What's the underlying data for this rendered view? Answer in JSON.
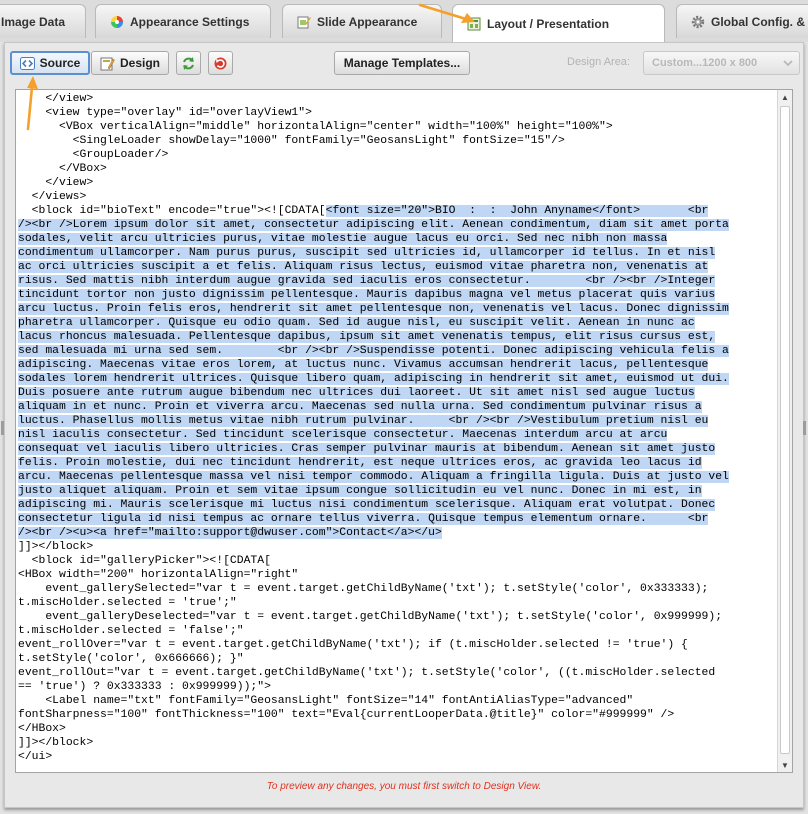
{
  "tabs": [
    {
      "label": "Image Data",
      "active": false
    },
    {
      "label": "Appearance Settings",
      "active": false
    },
    {
      "label": "Slide Appearance",
      "active": false
    },
    {
      "label": "Layout / Presentation",
      "active": true
    },
    {
      "label": "Global Config. &",
      "active": false
    }
  ],
  "toolbar": {
    "source_label": "Source",
    "design_label": "Design",
    "manage_templates_label": "Manage Templates...",
    "design_area_label": "Design Area:",
    "design_area_value": "Custom...1200 x 800"
  },
  "colors": {
    "accent_arrow": "#f5a02a",
    "selection": "#bfd6f4",
    "notice_text": "#e0311e"
  },
  "code": {
    "before_selection": "    </view>\n    <view type=\"overlay\" id=\"overlayView1\">\n      <VBox verticalAlign=\"middle\" horizontalAlign=\"center\" width=\"100%\" height=\"100%\">\n        <SingleLoader showDelay=\"1000\" fontFamily=\"GeosansLight\" fontSize=\"15\"/>\n        <GroupLoader/>\n      </VBox>\n    </view>\n  </views>\n  <block id=\"bioText\" encode=\"true\"><![CDATA[",
    "selected": "<font size=\"20\">BIO  :  :  John Anyname</font>       <br\n/><br />Lorem ipsum dolor sit amet, consectetur adipiscing elit. Aenean condimentum, diam sit amet porta\nsodales, velit arcu ultricies purus, vitae molestie augue lacus eu orci. Sed nec nibh non massa\ncondimentum ullamcorper. Nam purus purus, suscipit sed ultricies id, ullamcorper id tellus. In et nisl\nac orci ultricies suscipit a et felis. Aliquam risus lectus, euismod vitae pharetra non, venenatis at\nrisus. Sed mattis nibh interdum augue gravida sed iaculis eros consectetur.        <br /><br />Integer\ntincidunt tortor non justo dignissim pellentesque. Mauris dapibus magna vel metus placerat quis varius\narcu luctus. Proin felis eros, hendrerit sit amet pellentesque non, venenatis vel lacus. Donec dignissim\npharetra ullamcorper. Quisque eu odio quam. Sed id augue nisl, eu suscipit velit. Aenean in nunc ac\nlacus rhoncus malesuada. Pellentesque dapibus, ipsum sit amet venenatis tempus, elit risus cursus est,\nsed malesuada mi urna sed sem.        <br /><br />Suspendisse potenti. Donec adipiscing vehicula felis a\nadipiscing. Maecenas vitae eros lorem, at luctus nunc. Vivamus accumsan hendrerit lacus, pellentesque\nsodales lorem hendrerit ultrices. Quisque libero quam, adipiscing in hendrerit sit amet, euismod ut dui.\nDuis posuere ante rutrum augue bibendum nec ultrices dui laoreet. Ut sit amet nisl sed augue luctus\naliquam in et nunc. Proin et viverra arcu. Maecenas sed nulla urna. Sed condimentum pulvinar risus a\nluctus. Phasellus mollis metus vitae nibh rutrum pulvinar.     <br /><br />Vestibulum pretium nisl eu\nnisl iaculis consectetur. Sed tincidunt scelerisque consectetur. Maecenas interdum arcu at arcu\nconsequat vel iaculis libero ultricies. Cras semper pulvinar mauris at bibendum. Aenean sit amet justo\nfelis. Proin molestie, dui nec tincidunt hendrerit, est neque ultrices eros, ac gravida leo lacus id\narcu. Maecenas pellentesque massa vel nisi tempor commodo. Aliquam a fringilla ligula. Duis at justo vel\njusto aliquet aliquam. Proin et sem vitae ipsum congue sollicitudin eu vel nunc. Donec in mi est, in\nadipiscing mi. Mauris scelerisque mi luctus nisi condimentum scelerisque. Aliquam erat volutpat. Donec\nconsectetur ligula id nisi tempus ac ornare tellus viverra. Quisque tempus elementum ornare.      <br\n/><br /><u><a href=\"mailto:support@dwuser.com\">Contact</a></u>",
    "after_selection": "\n]]></block>\n  <block id=\"galleryPicker\"><![CDATA[\n<HBox width=\"200\" horizontalAlign=\"right\"\n    event_gallerySelected=\"var t = event.target.getChildByName('txt'); t.setStyle('color', 0x333333);\nt.miscHolder.selected = 'true';\"\n    event_galleryDeselected=\"var t = event.target.getChildByName('txt'); t.setStyle('color', 0x999999);\nt.miscHolder.selected = 'false';\"\nevent_rollOver=\"var t = event.target.getChildByName('txt'); if (t.miscHolder.selected != 'true') {\nt.setStyle('color', 0x666666); }\"\nevent_rollOut=\"var t = event.target.getChildByName('txt'); t.setStyle('color', ((t.miscHolder.selected\n== 'true') ? 0x333333 : 0x999999));\">\n    <Label name=\"txt\" fontFamily=\"GeosansLight\" fontSize=\"14\" fontAntiAliasType=\"advanced\"\nfontSharpness=\"100\" fontThickness=\"100\" text=\"Eval{currentLooperData.@title}\" color=\"#999999\" />\n</HBox>\n]]></block>\n</ui>"
  },
  "notice": "To preview any changes, you must first switch to Design View."
}
